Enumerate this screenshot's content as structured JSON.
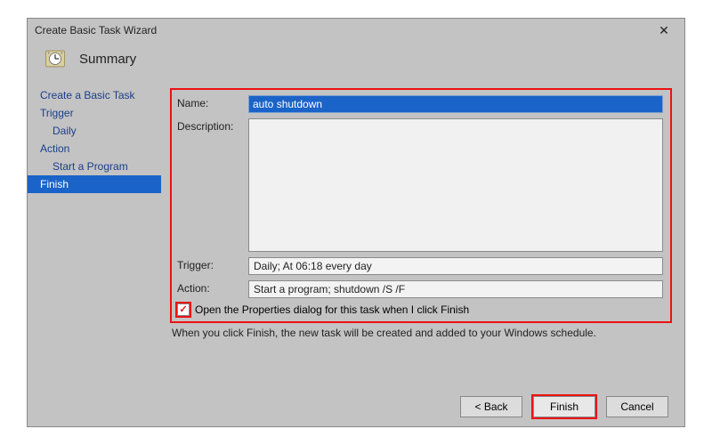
{
  "titlebar": {
    "text": "Create Basic Task Wizard"
  },
  "header": {
    "title": "Summary",
    "icon": "clock-icon"
  },
  "nav": {
    "items": [
      {
        "label": "Create a Basic Task",
        "indent": false,
        "selected": false
      },
      {
        "label": "Trigger",
        "indent": false,
        "selected": false
      },
      {
        "label": "Daily",
        "indent": true,
        "selected": false
      },
      {
        "label": "Action",
        "indent": false,
        "selected": false
      },
      {
        "label": "Start a Program",
        "indent": true,
        "selected": false
      },
      {
        "label": "Finish",
        "indent": false,
        "selected": true
      }
    ]
  },
  "form": {
    "name_label": "Name:",
    "name_value": "auto shutdown",
    "desc_label": "Description:",
    "desc_value": "",
    "trigger_label": "Trigger:",
    "trigger_value": "Daily; At 06:18 every day",
    "action_label": "Action:",
    "action_value": "Start a program; shutdown /S /F",
    "checkbox_label": "Open the Properties dialog for this task when I click Finish",
    "checkbox_checked": true,
    "note": "When you click Finish, the new task will be created and added to your Windows schedule."
  },
  "buttons": {
    "back": "< Back",
    "finish": "Finish",
    "cancel": "Cancel"
  }
}
